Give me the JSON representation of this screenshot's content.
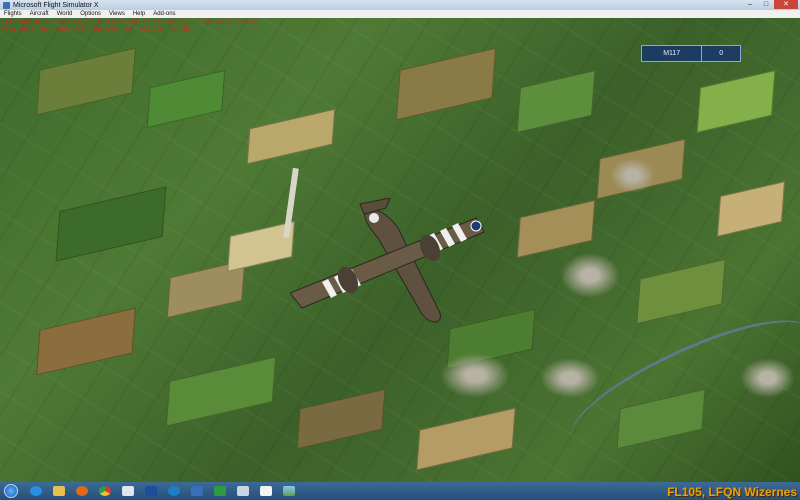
{
  "window": {
    "title": "Microsoft Flight Simulator X",
    "controls": [
      "–",
      "□",
      "✕"
    ]
  },
  "menu": {
    "items": [
      "Flights",
      "Aircraft",
      "World",
      "Options",
      "Views",
      "Help",
      "Add-ons"
    ]
  },
  "debug": {
    "line1": "Lat: N49 46.63 Lon: E4 42.31 Alt 10500 ft Hdg 94 GS 183 kts Wind 270/12",
    "line2": "Frm: 29.8 fps  LOD: 4.5  IAS 178  VS -100 fpm  AP ON"
  },
  "hud": {
    "id": "M117",
    "value": "0"
  },
  "caption": "FL105, LFQN Wizernes",
  "taskbar": {
    "icons": [
      "ie-icon",
      "folder-icon",
      "media-player-icon",
      "chrome-icon",
      "notepad-icon",
      "n-app-icon",
      "edge-icon",
      "paint-icon",
      "fsx-icon",
      "flight-icon",
      "app-window-icon",
      "tray-landscape-icon"
    ]
  },
  "colors": {
    "hud_bg": "#18366c",
    "caption": "#f0a000",
    "debug_text": "#d8261c",
    "taskbar": "#264f78"
  }
}
